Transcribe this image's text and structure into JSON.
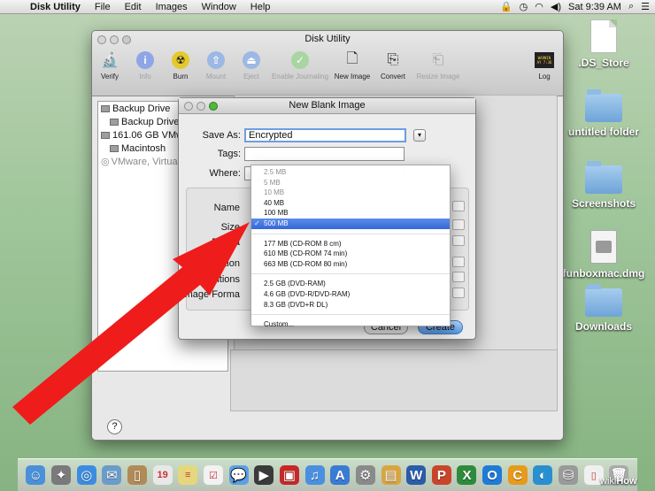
{
  "menubar": {
    "apple_icon": "apple-icon",
    "app_name": "Disk Utility",
    "items": [
      "File",
      "Edit",
      "Images",
      "Window",
      "Help"
    ],
    "clock": "Sat 9:39 AM",
    "status_icons": [
      "lock-icon",
      "time-machine-icon",
      "wifi-icon",
      "volume-icon",
      "spotlight-icon",
      "list-icon"
    ]
  },
  "desktop": {
    "items": [
      {
        "label": ".DS_Store",
        "icon": "document-icon"
      },
      {
        "label": "untitled folder",
        "icon": "folder-icon"
      },
      {
        "label": "Screenshots",
        "icon": "folder-icon"
      },
      {
        "label": "funboxmac.dmg",
        "icon": "disk-image-icon"
      },
      {
        "label": "Downloads",
        "icon": "folder-icon"
      }
    ]
  },
  "window": {
    "title": "Disk Utility",
    "toolbar": [
      {
        "label": "Verify",
        "icon": "microscope-icon",
        "enabled": true
      },
      {
        "label": "Info",
        "icon": "info-icon",
        "enabled": false
      },
      {
        "label": "Burn",
        "icon": "burn-icon",
        "enabled": true
      },
      {
        "label": "Mount",
        "icon": "mount-icon",
        "enabled": false
      },
      {
        "label": "Eject",
        "icon": "eject-icon",
        "enabled": false
      },
      {
        "label": "Enable Journaling",
        "icon": "journaling-icon",
        "enabled": false
      },
      {
        "label": "New Image",
        "icon": "new-image-icon",
        "enabled": true
      },
      {
        "label": "Convert",
        "icon": "convert-icon",
        "enabled": true
      },
      {
        "label": "Resize Image",
        "icon": "resize-image-icon",
        "enabled": false
      },
      {
        "label": "Log",
        "icon": "log-icon",
        "enabled": true
      }
    ],
    "log_badge": "WARNIN\nAY 7:36",
    "sidebar": [
      {
        "label": "Backup Drive",
        "level": 0
      },
      {
        "label": "Backup Drive",
        "level": 1
      },
      {
        "label": "161.06 GB VMware",
        "level": 0
      },
      {
        "label": "Macintosh",
        "level": 1
      },
      {
        "label": "VMware, Virtual C",
        "level": 0,
        "dim": true
      }
    ],
    "help": "?"
  },
  "sheet": {
    "title": "New Blank Image",
    "save_as_label": "Save As:",
    "save_as_value": "Encrypted",
    "tags_label": "Tags:",
    "tags_value": "",
    "where_label": "Where:",
    "group_labels": [
      "Name",
      "Size",
      "Forma",
      "Encryption",
      "Partitions",
      "Image Forma"
    ],
    "cancel": "Cancel",
    "create": "Create"
  },
  "size_menu": {
    "groups": [
      [
        {
          "label": "2.5 MB",
          "dim": true
        },
        {
          "label": "5 MB",
          "dim": true
        },
        {
          "label": "10 MB",
          "dim": true
        },
        {
          "label": "40 MB"
        },
        {
          "label": "100 MB"
        },
        {
          "label": "500 MB",
          "selected": true
        }
      ],
      [
        {
          "label": "177 MB (CD-ROM 8 cm)"
        },
        {
          "label": "610 MB (CD-ROM 74 min)"
        },
        {
          "label": "663 MB (CD-ROM 80 min)"
        }
      ],
      [
        {
          "label": "2.5 GB (DVD-RAM)"
        },
        {
          "label": "4.6 GB (DVD-R/DVD-RAM)"
        },
        {
          "label": "8.3 GB (DVD+R DL)"
        }
      ],
      [
        {
          "label": "Custom..."
        }
      ]
    ],
    "check": "✓"
  },
  "dock": {
    "items": [
      {
        "icon": "finder-icon",
        "color": "#4a90d9",
        "glyph": "☺"
      },
      {
        "icon": "launchpad-icon",
        "color": "#7a7a7a",
        "glyph": "✦"
      },
      {
        "icon": "safari-icon",
        "color": "#3c8de0",
        "glyph": "◎"
      },
      {
        "icon": "mail-icon",
        "color": "#6b9cc9",
        "glyph": "✉"
      },
      {
        "icon": "contacts-icon",
        "color": "#b08a57",
        "glyph": "▯"
      },
      {
        "icon": "calendar-icon",
        "color": "#e8e8e8",
        "glyph": "19"
      },
      {
        "icon": "notes-icon",
        "color": "#e6d77c",
        "glyph": "≡"
      },
      {
        "icon": "reminders-icon",
        "color": "#f2f2f2",
        "glyph": "☑"
      },
      {
        "icon": "messages-icon",
        "color": "#5aa0e6",
        "glyph": "💬"
      },
      {
        "icon": "facetime-icon",
        "color": "#3a3a3a",
        "glyph": "▶"
      },
      {
        "icon": "photo-booth-icon",
        "color": "#c62828",
        "glyph": "▣"
      },
      {
        "icon": "itunes-icon",
        "color": "#4a8fe0",
        "glyph": "♫"
      },
      {
        "icon": "app-store-icon",
        "color": "#3a7bd5",
        "glyph": "A"
      },
      {
        "icon": "system-preferences-icon",
        "color": "#8a8a8a",
        "glyph": "⚙"
      },
      {
        "icon": "stickies-icon",
        "color": "#d9a441",
        "glyph": "▤"
      },
      {
        "icon": "word-icon",
        "color": "#2b5ca8",
        "glyph": "W"
      },
      {
        "icon": "powerpoint-icon",
        "color": "#c8452b",
        "glyph": "P"
      },
      {
        "icon": "excel-icon",
        "color": "#2e8a3c",
        "glyph": "X"
      },
      {
        "icon": "outlook-icon",
        "color": "#1f7bd6",
        "glyph": "O"
      },
      {
        "icon": "lync-icon",
        "color": "#e79a1b",
        "glyph": "C"
      },
      {
        "icon": "app-icon",
        "color": "#2a8fd0",
        "glyph": "◐"
      },
      {
        "icon": "disk-utility-icon",
        "color": "#9a9a9a",
        "glyph": "⛁"
      },
      {
        "icon": "document-icon",
        "color": "#f0f0f0",
        "glyph": "▯"
      },
      {
        "icon": "trash-icon",
        "color": "#a9a9a9",
        "glyph": "🗑"
      }
    ]
  },
  "watermark": {
    "prefix": "wiki",
    "suffix": "How"
  }
}
